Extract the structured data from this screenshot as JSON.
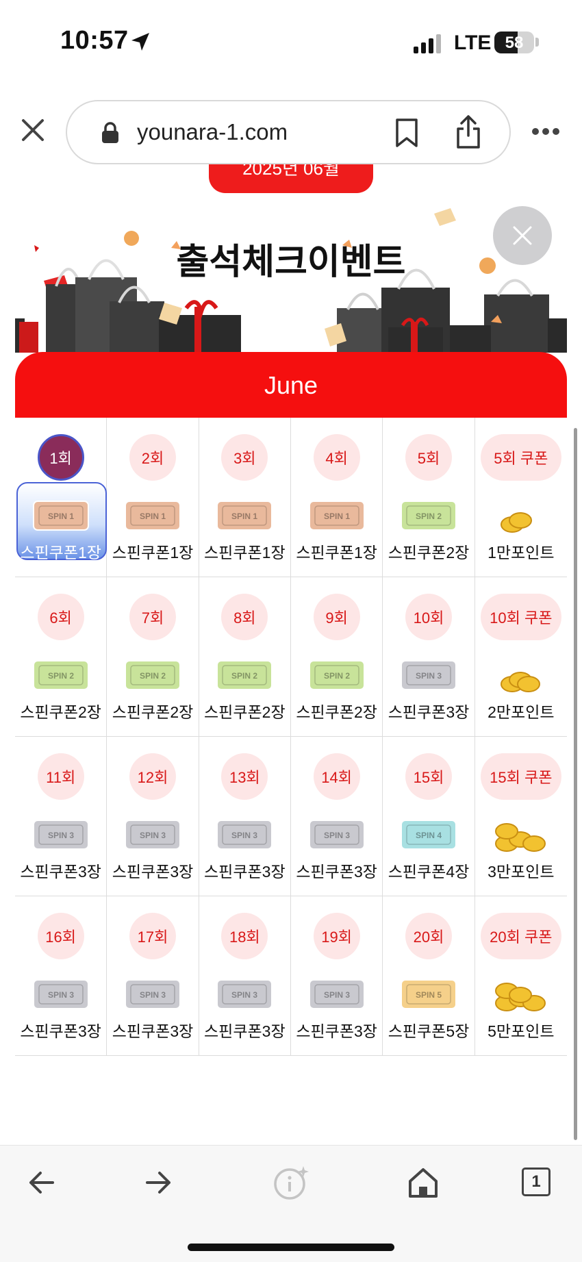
{
  "status_bar": {
    "time": "10:57",
    "network": "LTE",
    "battery": "58",
    "battery_level": 0.58
  },
  "browser": {
    "url": "younara-1.com"
  },
  "page": {
    "date_pill": "2025년 06월",
    "banner_title": "출석체크이벤트",
    "month": "June"
  },
  "colors": {
    "accent_red": "#f50f0f",
    "badge_bg": "#fde6e6",
    "badge_text": "#d81818",
    "selected_blue": "#4a62d6"
  },
  "rewards": [
    {
      "day": "1회",
      "prize": "스핀쿠폰1장",
      "icon": "ticket-spin-1",
      "active": true
    },
    {
      "day": "2회",
      "prize": "스핀쿠폰1장",
      "icon": "ticket-spin-1"
    },
    {
      "day": "3회",
      "prize": "스핀쿠폰1장",
      "icon": "ticket-spin-1"
    },
    {
      "day": "4회",
      "prize": "스핀쿠폰1장",
      "icon": "ticket-spin-1"
    },
    {
      "day": "5회",
      "prize": "스핀쿠폰2장",
      "icon": "ticket-spin-2"
    },
    {
      "day": "5회 쿠폰",
      "prize": "1만포인트",
      "icon": "coins-small",
      "wide": true
    },
    {
      "day": "6회",
      "prize": "스핀쿠폰2장",
      "icon": "ticket-spin-2"
    },
    {
      "day": "7회",
      "prize": "스핀쿠폰2장",
      "icon": "ticket-spin-2"
    },
    {
      "day": "8회",
      "prize": "스핀쿠폰2장",
      "icon": "ticket-spin-2"
    },
    {
      "day": "9회",
      "prize": "스핀쿠폰2장",
      "icon": "ticket-spin-2"
    },
    {
      "day": "10회",
      "prize": "스핀쿠폰3장",
      "icon": "ticket-spin-3"
    },
    {
      "day": "10회 쿠폰",
      "prize": "2만포인트",
      "icon": "coins-medium",
      "wide": true
    },
    {
      "day": "11회",
      "prize": "스핀쿠폰3장",
      "icon": "ticket-spin-3"
    },
    {
      "day": "12회",
      "prize": "스핀쿠폰3장",
      "icon": "ticket-spin-3"
    },
    {
      "day": "13회",
      "prize": "스핀쿠폰3장",
      "icon": "ticket-spin-3"
    },
    {
      "day": "14회",
      "prize": "스핀쿠폰3장",
      "icon": "ticket-spin-3"
    },
    {
      "day": "15회",
      "prize": "스핀쿠폰4장",
      "icon": "ticket-spin-4"
    },
    {
      "day": "15회 쿠폰",
      "prize": "3만포인트",
      "icon": "coins-large",
      "wide": true
    },
    {
      "day": "16회",
      "prize": "스핀쿠폰3장",
      "icon": "ticket-spin-3"
    },
    {
      "day": "17회",
      "prize": "스핀쿠폰3장",
      "icon": "ticket-spin-3"
    },
    {
      "day": "18회",
      "prize": "스핀쿠폰3장",
      "icon": "ticket-spin-3"
    },
    {
      "day": "19회",
      "prize": "스핀쿠폰3장",
      "icon": "ticket-spin-3"
    },
    {
      "day": "20회",
      "prize": "스핀쿠폰5장",
      "icon": "ticket-spin-5"
    },
    {
      "day": "20회 쿠폰",
      "prize": "5만포인트",
      "icon": "coins-pile",
      "wide": true
    }
  ],
  "ticket_labels": {
    "ticket-spin-1": "SPIN 1",
    "ticket-spin-2": "SPIN 2",
    "ticket-spin-3": "SPIN 3",
    "ticket-spin-4": "SPIN 4",
    "ticket-spin-5": "SPIN 5"
  },
  "ticket_colors": {
    "ticket-spin-1": "#e9b99c",
    "ticket-spin-2": "#c8e39a",
    "ticket-spin-3": "#c9c9cf",
    "ticket-spin-4": "#a8e0e2",
    "ticket-spin-5": "#f5d08a"
  },
  "toolbar": {
    "icons": [
      "back-arrow-icon",
      "forward-arrow-icon",
      "info-sparkle-icon",
      "home-icon",
      "tabs-icon"
    ],
    "tab_count": "1"
  }
}
